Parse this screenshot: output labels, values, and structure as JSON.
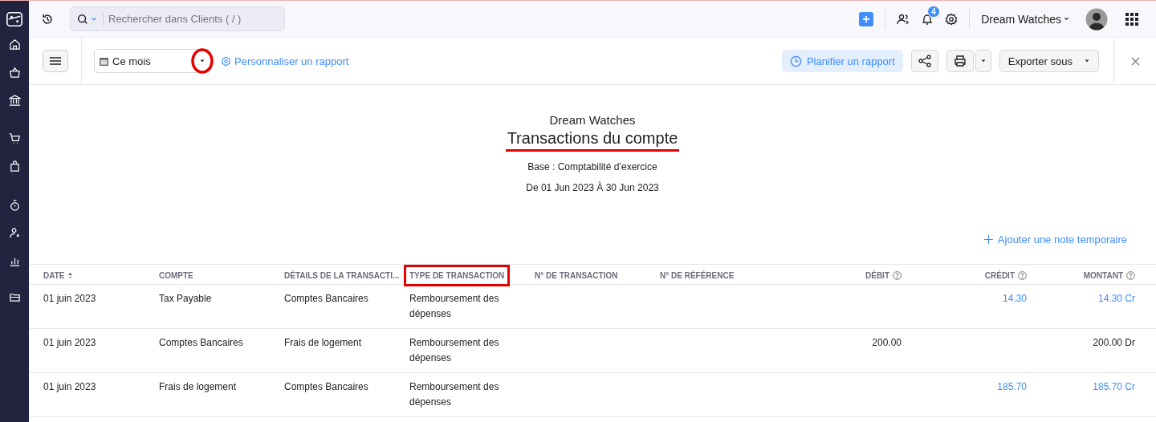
{
  "topbar": {
    "search": {
      "placeholder": "Rechercher dans Clients ( / )"
    },
    "notifications": "4",
    "organization": "Dream Watches"
  },
  "toolbar": {
    "period": {
      "value": "Ce mois",
      "circled": true
    },
    "customize_link": "Personnaliser un rapport",
    "schedule_button": "Planifier un rapport",
    "export_button": "Exporter sous"
  },
  "report": {
    "company": "Dream Watches",
    "title": {
      "text": "Transactions du compte",
      "underlined": true
    },
    "basis": "Base : Comptabilité d’exercice",
    "period": "De 01 Jun 2023 À 30 Jun 2023",
    "note_link": "Ajouter une note temporaire"
  },
  "table": {
    "columns": [
      {
        "kind": "text",
        "label": "DATE",
        "sorted": true,
        "help": false,
        "highlighted": false
      },
      {
        "kind": "text",
        "label": "COMPTE",
        "sorted": false,
        "help": false,
        "highlighted": false
      },
      {
        "kind": "text",
        "label": "DÉTAILS DE LA TRANSACTI...",
        "sorted": false,
        "help": false,
        "highlighted": false
      },
      {
        "kind": "text",
        "label": "TYPE DE TRANSACTION",
        "sorted": false,
        "help": false,
        "highlighted": true
      },
      {
        "kind": "text",
        "label": "N° DE TRANSACTION",
        "sorted": false,
        "help": false,
        "highlighted": false
      },
      {
        "kind": "text",
        "label": "N° DE RÉFÉRENCE",
        "sorted": false,
        "help": false,
        "highlighted": false
      },
      {
        "kind": "number",
        "label": "DÉBIT",
        "sorted": false,
        "help": true,
        "highlighted": false
      },
      {
        "kind": "number",
        "label": "CRÉDIT",
        "sorted": false,
        "help": true,
        "highlighted": false
      },
      {
        "kind": "number",
        "label": "MONTANT",
        "sorted": false,
        "help": true,
        "highlighted": false
      }
    ],
    "rows": [
      {
        "date": {
          "text": "01 juin 2023",
          "link": false
        },
        "account": {
          "text": "Tax Payable",
          "link": false
        },
        "details": {
          "text": "Comptes Bancaires",
          "link": false
        },
        "type": {
          "text": "Remboursement des dépenses",
          "link": false
        },
        "credit": {
          "text": "14.30",
          "link": true
        },
        "amount": {
          "text": "14.30 Cr",
          "link": true
        }
      },
      {
        "date": {
          "text": "01 juin 2023",
          "link": false
        },
        "account": {
          "text": "Comptes Bancaires",
          "link": false
        },
        "details": {
          "text": "Frais de logement",
          "link": false
        },
        "type": {
          "text": "Remboursement des dépenses",
          "link": false
        },
        "debit": {
          "text": "200.00",
          "link": false
        },
        "amount": {
          "text": "200.00 Dr",
          "link": false
        }
      },
      {
        "date": {
          "text": "01 juin 2023",
          "link": false
        },
        "account": {
          "text": "Frais de logement",
          "link": false
        },
        "details": {
          "text": "Comptes Bancaires",
          "link": false
        },
        "type": {
          "text": "Remboursement des dépenses",
          "link": false
        },
        "credit": {
          "text": "185.70",
          "link": true
        },
        "amount": {
          "text": "185.70 Cr",
          "link": true
        }
      }
    ]
  }
}
